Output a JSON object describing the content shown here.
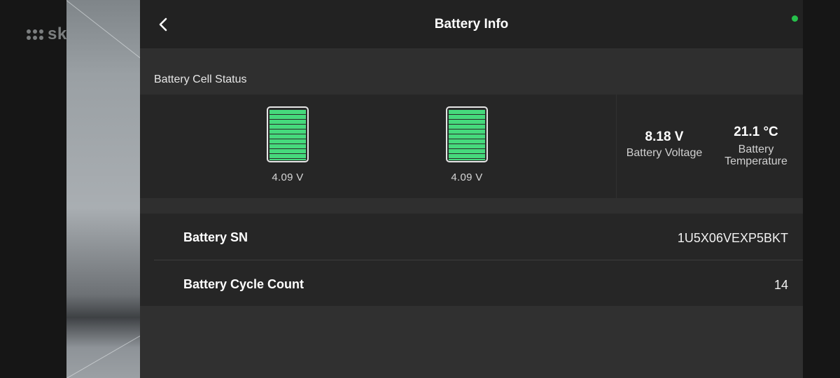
{
  "watermark": {
    "text": "skelbiu.lt"
  },
  "header": {
    "title": "Battery Info"
  },
  "section": {
    "title": "Battery Cell Status"
  },
  "cells": [
    {
      "voltage": "4.09 V",
      "charge_level": 1.0
    },
    {
      "voltage": "4.09 V",
      "charge_level": 1.0
    }
  ],
  "stats": {
    "voltage": {
      "value": "8.18 V",
      "label": "Battery Voltage"
    },
    "temperature": {
      "value": "21.1 °C",
      "label_line1": "Battery",
      "label_line2": "Temperature"
    }
  },
  "info": {
    "sn": {
      "label": "Battery SN",
      "value": "1U5X06VEXP5BKT"
    },
    "cycle": {
      "label": "Battery Cycle Count",
      "value": "14"
    }
  },
  "colors": {
    "cell_fill": "#46d97c",
    "status_dot": "#26c04b",
    "background": "#303030"
  },
  "icons": {
    "back": "chevron-left-icon",
    "status": "status-dot-icon"
  }
}
